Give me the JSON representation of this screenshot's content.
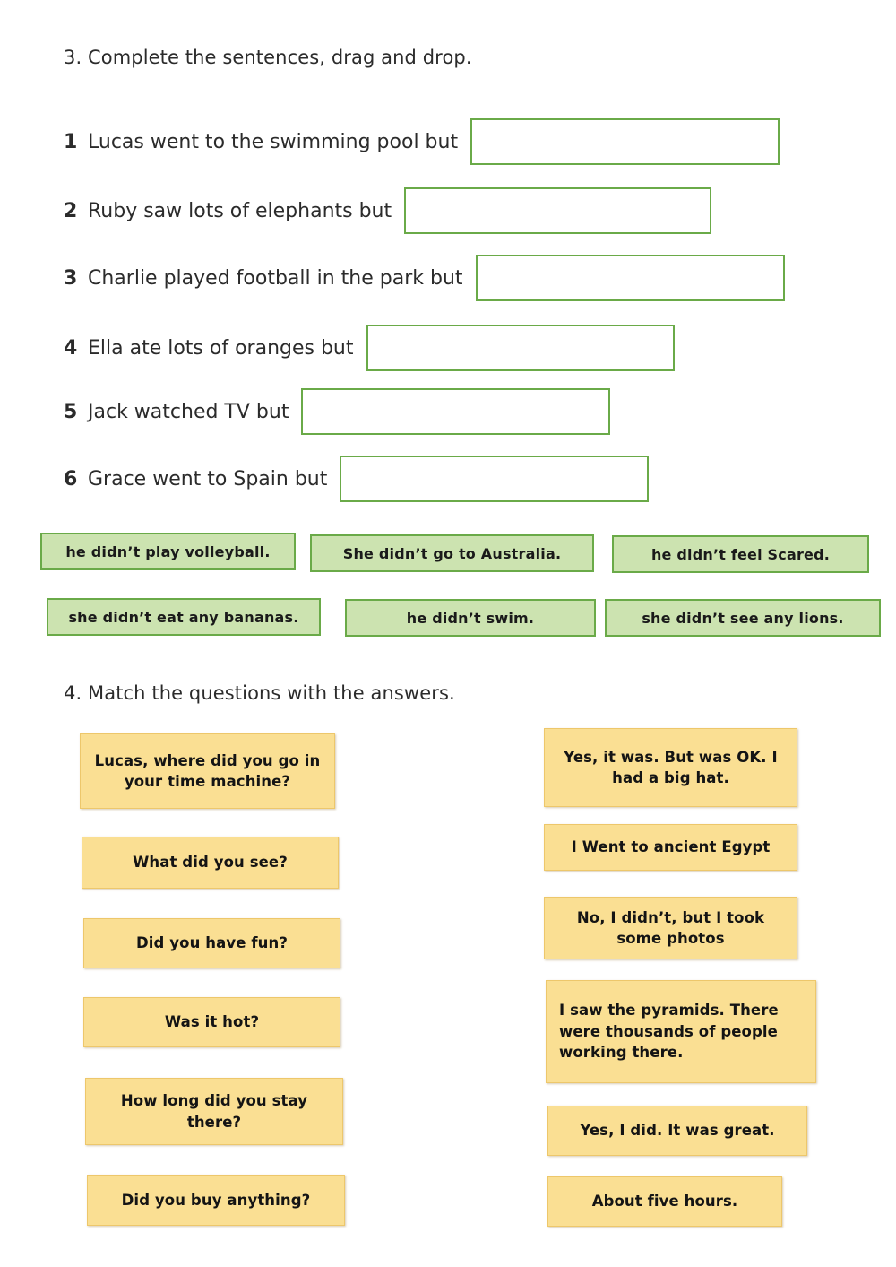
{
  "colors": {
    "green_border": "#6aaa48",
    "green_fill": "#cce3b0",
    "yellow_fill": "#fadf93",
    "yellow_border": "#edc76b",
    "text": "#2b2b2b",
    "page_background": "#ffffff"
  },
  "exercise3": {
    "heading": "3. Complete the sentences, drag and drop.",
    "sentences": [
      {
        "num": "1",
        "text": "Lucas went to the swimming pool but"
      },
      {
        "num": "2",
        "text": "Ruby saw lots of elephants but"
      },
      {
        "num": "3",
        "text": "Charlie played football in the park but"
      },
      {
        "num": "4",
        "text": "Ella ate lots of oranges but"
      },
      {
        "num": "5",
        "text": "Jack watched TV but"
      },
      {
        "num": "6",
        "text": "Grace went to Spain but"
      }
    ],
    "drop_zone_values": [
      "",
      "",
      "",
      "",
      "",
      ""
    ],
    "draggable_tiles": [
      {
        "label": "he didn’t play volleyball."
      },
      {
        "label": "She didn’t go to Australia."
      },
      {
        "label": "he didn’t feel Scared."
      },
      {
        "label": "she didn’t eat any bananas."
      },
      {
        "label": "he didn’t swim."
      },
      {
        "label": "she didn’t see any lions."
      }
    ]
  },
  "exercise4": {
    "heading": "4. Match the questions with the answers.",
    "questions": [
      {
        "label": "Lucas, where did you go in your time machine?"
      },
      {
        "label": "What did you see?"
      },
      {
        "label": "Did you have fun?"
      },
      {
        "label": "Was it hot?"
      },
      {
        "label": "How long did you stay there?"
      },
      {
        "label": "Did you buy anything?"
      }
    ],
    "answers": [
      {
        "label": "Yes, it was. But was OK. I had a big hat."
      },
      {
        "label": "I Went to ancient Egypt"
      },
      {
        "label": "No, I didn’t, but I took some photos"
      },
      {
        "label": "I saw the pyramids. There were thousands of people working there."
      },
      {
        "label": "Yes, I did. It was great."
      },
      {
        "label": "About five hours."
      }
    ]
  }
}
